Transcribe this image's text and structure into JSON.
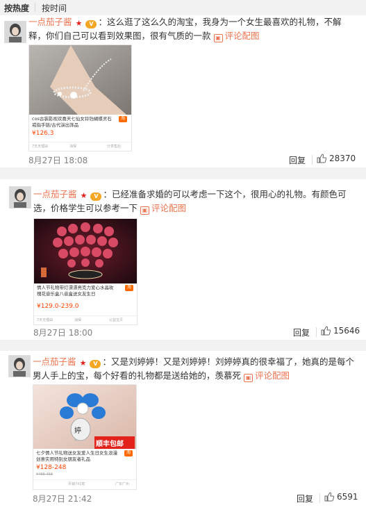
{
  "sort": {
    "hot": "按热度",
    "time": "按时间"
  },
  "comments": [
    {
      "user": "一点茄子酱",
      "text": "：这么逛了这么久的淘宝，我身为一个女生最喜欢的礼物，不解释，你们自己可以看到效果图，很有气质的一款",
      "review": "评论配图",
      "product": {
        "title": "cos古装影视欢喜天七仙女铃铛蝴蝶灵石戒指手链/古代演出饰品",
        "price": "¥126.3",
        "shop": "淘",
        "foot_left": "7天无理由",
        "foot_mid": "消保",
        "foot_right": "分享售后"
      },
      "time": "8月27日 18:08",
      "reply": "回复",
      "likes": "28370"
    },
    {
      "user": "一点茄子酱",
      "text": "：已经准备求婚的可以考虑一下这个，很用心的礼物。有颜色可选，价格学生可以参考一下",
      "review": "评论配图",
      "product": {
        "title": "情人节礼物带灯漂漂亮克力爱心水晶玫瑰花音乐盒八音盒送女友生日",
        "price": "¥129.0-239.0",
        "shop": "淘",
        "foot_left": "7天无理由",
        "foot_mid": "消保",
        "foot_right": "公益宝贝"
      },
      "time": "8月27日 18:00",
      "reply": "回复",
      "likes": "15646"
    },
    {
      "user": "一点茄子酱",
      "text": "：又是刘婷婷！又是刘婷婷！刘婷婷真的很幸福了，她真的是每个男人手上的宝，每个好看的礼物都是送给她的，羡慕死",
      "review": "评论配图",
      "product": {
        "banner": "顺丰包邮",
        "charm": "婷",
        "title": "七夕情人节礼物送女友爱人生日女生浪漫创意实用特别女朋友者礼品",
        "price": "¥128-248",
        "old_price": "¥488-458",
        "shop": "淘",
        "foot_left": "月销742笔",
        "foot_right": "广东广州"
      },
      "time": "8月27日 21:42",
      "reply": "回复",
      "likes": "6591"
    }
  ],
  "colors": {
    "username": "#eb7350",
    "price": "#ff4400"
  }
}
